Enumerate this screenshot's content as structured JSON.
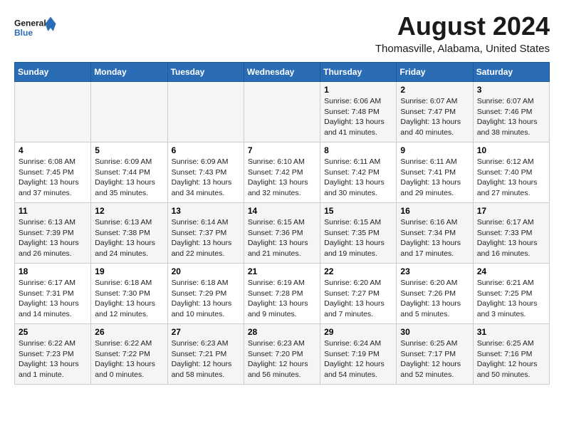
{
  "logo": {
    "line1": "General",
    "line2": "Blue"
  },
  "title": "August 2024",
  "subtitle": "Thomasville, Alabama, United States",
  "days_of_week": [
    "Sunday",
    "Monday",
    "Tuesday",
    "Wednesday",
    "Thursday",
    "Friday",
    "Saturday"
  ],
  "weeks": [
    [
      {
        "day": "",
        "info": ""
      },
      {
        "day": "",
        "info": ""
      },
      {
        "day": "",
        "info": ""
      },
      {
        "day": "",
        "info": ""
      },
      {
        "day": "1",
        "info": "Sunrise: 6:06 AM\nSunset: 7:48 PM\nDaylight: 13 hours\nand 41 minutes."
      },
      {
        "day": "2",
        "info": "Sunrise: 6:07 AM\nSunset: 7:47 PM\nDaylight: 13 hours\nand 40 minutes."
      },
      {
        "day": "3",
        "info": "Sunrise: 6:07 AM\nSunset: 7:46 PM\nDaylight: 13 hours\nand 38 minutes."
      }
    ],
    [
      {
        "day": "4",
        "info": "Sunrise: 6:08 AM\nSunset: 7:45 PM\nDaylight: 13 hours\nand 37 minutes."
      },
      {
        "day": "5",
        "info": "Sunrise: 6:09 AM\nSunset: 7:44 PM\nDaylight: 13 hours\nand 35 minutes."
      },
      {
        "day": "6",
        "info": "Sunrise: 6:09 AM\nSunset: 7:43 PM\nDaylight: 13 hours\nand 34 minutes."
      },
      {
        "day": "7",
        "info": "Sunrise: 6:10 AM\nSunset: 7:42 PM\nDaylight: 13 hours\nand 32 minutes."
      },
      {
        "day": "8",
        "info": "Sunrise: 6:11 AM\nSunset: 7:42 PM\nDaylight: 13 hours\nand 30 minutes."
      },
      {
        "day": "9",
        "info": "Sunrise: 6:11 AM\nSunset: 7:41 PM\nDaylight: 13 hours\nand 29 minutes."
      },
      {
        "day": "10",
        "info": "Sunrise: 6:12 AM\nSunset: 7:40 PM\nDaylight: 13 hours\nand 27 minutes."
      }
    ],
    [
      {
        "day": "11",
        "info": "Sunrise: 6:13 AM\nSunset: 7:39 PM\nDaylight: 13 hours\nand 26 minutes."
      },
      {
        "day": "12",
        "info": "Sunrise: 6:13 AM\nSunset: 7:38 PM\nDaylight: 13 hours\nand 24 minutes."
      },
      {
        "day": "13",
        "info": "Sunrise: 6:14 AM\nSunset: 7:37 PM\nDaylight: 13 hours\nand 22 minutes."
      },
      {
        "day": "14",
        "info": "Sunrise: 6:15 AM\nSunset: 7:36 PM\nDaylight: 13 hours\nand 21 minutes."
      },
      {
        "day": "15",
        "info": "Sunrise: 6:15 AM\nSunset: 7:35 PM\nDaylight: 13 hours\nand 19 minutes."
      },
      {
        "day": "16",
        "info": "Sunrise: 6:16 AM\nSunset: 7:34 PM\nDaylight: 13 hours\nand 17 minutes."
      },
      {
        "day": "17",
        "info": "Sunrise: 6:17 AM\nSunset: 7:33 PM\nDaylight: 13 hours\nand 16 minutes."
      }
    ],
    [
      {
        "day": "18",
        "info": "Sunrise: 6:17 AM\nSunset: 7:31 PM\nDaylight: 13 hours\nand 14 minutes."
      },
      {
        "day": "19",
        "info": "Sunrise: 6:18 AM\nSunset: 7:30 PM\nDaylight: 13 hours\nand 12 minutes."
      },
      {
        "day": "20",
        "info": "Sunrise: 6:18 AM\nSunset: 7:29 PM\nDaylight: 13 hours\nand 10 minutes."
      },
      {
        "day": "21",
        "info": "Sunrise: 6:19 AM\nSunset: 7:28 PM\nDaylight: 13 hours\nand 9 minutes."
      },
      {
        "day": "22",
        "info": "Sunrise: 6:20 AM\nSunset: 7:27 PM\nDaylight: 13 hours\nand 7 minutes."
      },
      {
        "day": "23",
        "info": "Sunrise: 6:20 AM\nSunset: 7:26 PM\nDaylight: 13 hours\nand 5 minutes."
      },
      {
        "day": "24",
        "info": "Sunrise: 6:21 AM\nSunset: 7:25 PM\nDaylight: 13 hours\nand 3 minutes."
      }
    ],
    [
      {
        "day": "25",
        "info": "Sunrise: 6:22 AM\nSunset: 7:23 PM\nDaylight: 13 hours\nand 1 minute."
      },
      {
        "day": "26",
        "info": "Sunrise: 6:22 AM\nSunset: 7:22 PM\nDaylight: 13 hours\nand 0 minutes."
      },
      {
        "day": "27",
        "info": "Sunrise: 6:23 AM\nSunset: 7:21 PM\nDaylight: 12 hours\nand 58 minutes."
      },
      {
        "day": "28",
        "info": "Sunrise: 6:23 AM\nSunset: 7:20 PM\nDaylight: 12 hours\nand 56 minutes."
      },
      {
        "day": "29",
        "info": "Sunrise: 6:24 AM\nSunset: 7:19 PM\nDaylight: 12 hours\nand 54 minutes."
      },
      {
        "day": "30",
        "info": "Sunrise: 6:25 AM\nSunset: 7:17 PM\nDaylight: 12 hours\nand 52 minutes."
      },
      {
        "day": "31",
        "info": "Sunrise: 6:25 AM\nSunset: 7:16 PM\nDaylight: 12 hours\nand 50 minutes."
      }
    ]
  ]
}
